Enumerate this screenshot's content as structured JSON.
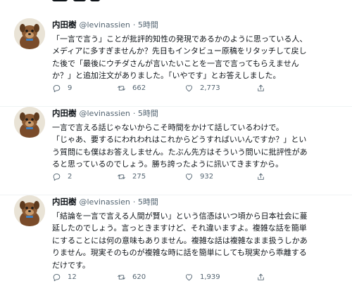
{
  "tweets": [
    {
      "name": "内田樹",
      "handle": "@levinassien",
      "time": "· 5時間",
      "lines": [
        "「一言で言う」ことが批評的知性の発現であるかのように思っている人、",
        "メディアに多すぎませんか？先日もインタビュー原稿をリタッチして戻し",
        "た後で「最後にウチダさんが言いたいことを一言で言ってもらえません",
        "か？」と追加注文がありました。「いやです」とお答えしました。"
      ],
      "replies": "9",
      "retweets": "662",
      "likes": "2,773"
    },
    {
      "name": "内田樹",
      "handle": "@levinassien",
      "time": "· 5時間",
      "lines": [
        "一言で言える話じゃないからこそ時間をかけて話しているわけで。",
        "「じゃあ、要するにわれわれはこれからどうすればいいんですか？」とい",
        "う質問にも僕はお答えしません。たぶん先方はそういう問いに批評性があ",
        "ると思っているのでしょう。勝ち誇ったように訊いてきますから。"
      ],
      "replies": "2",
      "retweets": "275",
      "likes": "932"
    },
    {
      "name": "内田樹",
      "handle": "@levinassien",
      "time": "· 5時間",
      "lines": [
        "「結論を一言で言える人間が賢い」という信憑はいつ頃から日本社会に蔓",
        "延したのでしょう。言っときますけど、それ違いますよ。複雑な話を簡単",
        "にすることには何の意味もありません。複雑な話は複雑なまま扱うしかあ",
        "りません。現実そのものが複雑な時に話を簡単にしても現実から乖離する",
        "だけです。"
      ],
      "replies": "12",
      "retweets": "620",
      "likes": "1,939"
    }
  ],
  "icons": {
    "reply": "reply-icon",
    "retweet": "retweet-icon",
    "like": "heart-icon",
    "share": "share-icon"
  },
  "colors": {
    "text": "#0f1419",
    "muted": "#536471",
    "divider": "#eff3f4"
  }
}
